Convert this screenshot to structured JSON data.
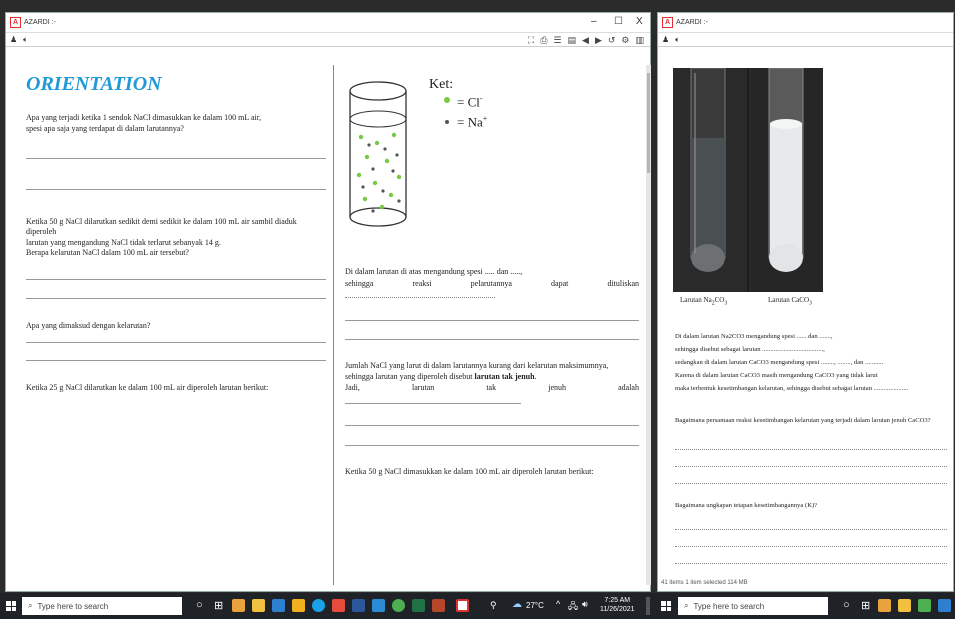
{
  "left_window": {
    "title": "AZARDI :-",
    "controls": {
      "minimize": "–",
      "maximize": "☐",
      "close": "X"
    },
    "left_page": {
      "heading": "ORIENTATION",
      "q1_line1": "Apa yang terjadi ketika 1 sendok NaCl dimasukkan ke dalam 100 mL air,",
      "q1_line2": "spesi apa saja yang terdapat di dalam larutannya?",
      "q2_line1": "Ketika 50 g NaCl dilarutkan sedikit demi sedikit ke dalam 100 mL air sambil diaduk",
      "q2_line2": "diperoleh",
      "q2_line3": "larutan yang mengandung NaCl tidak terlarut sebanyak 14 g.",
      "q2_line4": "Berapa kelarutan NaCl dalam 100 mL air tersebut?",
      "q3": "Apa yang dimaksud dengan kelarutan?",
      "q4": "Ketika 25 g NaCl dilarutkan ke dalam 100 mL air diperoleh larutan berikut:"
    },
    "right_page": {
      "ket_label": "Ket:",
      "legend_cl": "= Cl",
      "legend_cl_sup": "-",
      "legend_na": "= Na",
      "legend_na_sup": "+",
      "p1_line1": "Di dalam larutan di atas mengandung spesi ..... dan .....,",
      "p1_w1": "sehingga",
      "p1_w2": "reaksi",
      "p1_w3": "pelarutannya",
      "p1_w4": "dapat",
      "p1_w5": "dituliskan",
      "p2_line1": "Jumlah NaCl yang larut di dalam larutannya kurang dari kelarutan maksimumnya,",
      "p2_line2a": "sehingga larutan yang diperoleh disebut ",
      "p2_line2b": "larutan tak jenuh",
      "p2_line2c": ".",
      "p2_w1": "Jadi,",
      "p2_w2": "larutan",
      "p2_w3": "tak",
      "p2_w4": "jenuh",
      "p2_w5": "adalah",
      "p3": "Ketika 50 g NaCl dimasukkan ke dalam 100 mL air diperoleh larutan berikut:"
    }
  },
  "right_window": {
    "title": "AZARDI :-",
    "caption_left": "Larutan Na",
    "caption_left_sub": "2",
    "caption_left_end": "CO",
    "caption_left_sub2": "3",
    "caption_right": "Larutan CaCO",
    "caption_right_sub": "3",
    "t1": "Di dalam larutan Na2CO3 mengandung spesi ...... dan .......,",
    "t2": "sehingga disebut sebagai larutan .....................................,",
    "t3": "sedangkan di dalam larutan CaCO3 mengandung spesi ........, ........, dan ...........",
    "t4": "Karena di dalam larutan CaCO3 masih mengandung CaCO3 yang tidak larut",
    "t5": "maka terbentuk kesetimbangan kelarutan, sehingga disebut sebagai larutan .....................",
    "q1": "Bagaimana persamaan reaksi kesetimbangan kelarutan yang terjadi dalam larutan jenuh CaCO3?",
    "q2": "Bagaimana ungkapan tetapan kesetimbangannya (K)?",
    "status": "41 items   1 item selected 114 MB"
  },
  "taskbar": {
    "search_placeholder": "Type here to search",
    "weather": "27°C",
    "time": "7:25 AM",
    "date": "11/26/2021",
    "search_placeholder_2": "Type here to search"
  }
}
